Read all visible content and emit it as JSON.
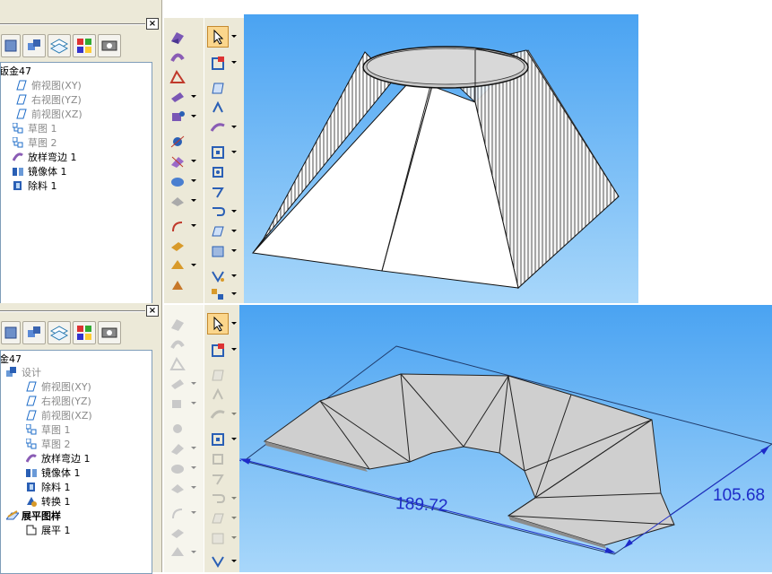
{
  "top_panel": {
    "tree": [
      {
        "label": "钣金47",
        "style": "root"
      },
      {
        "label": "俯视图(XY)",
        "style": "grey"
      },
      {
        "label": "右视图(YZ)",
        "style": "grey"
      },
      {
        "label": "前视图(XZ)",
        "style": "grey"
      },
      {
        "label": "草图 1",
        "style": "grey"
      },
      {
        "label": "草图 2",
        "style": "grey"
      },
      {
        "label": "放样弯边 1",
        "style": "normal"
      },
      {
        "label": "镜像体 1",
        "style": "normal"
      },
      {
        "label": "除料 1",
        "style": "normal"
      }
    ]
  },
  "bottom_panel": {
    "tree": [
      {
        "label": "金47",
        "style": "root"
      },
      {
        "label": "设计",
        "style": "grey"
      },
      {
        "label": "俯视图(XY)",
        "style": "grey"
      },
      {
        "label": "右视图(YZ)",
        "style": "grey"
      },
      {
        "label": "前视图(XZ)",
        "style": "grey"
      },
      {
        "label": "草图 1",
        "style": "grey"
      },
      {
        "label": "草图 2",
        "style": "grey"
      },
      {
        "label": "放样弯边 1",
        "style": "normal"
      },
      {
        "label": "镜像体 1",
        "style": "normal"
      },
      {
        "label": "除料 1",
        "style": "normal"
      },
      {
        "label": "转换 1",
        "style": "normal"
      },
      {
        "label": "展平图样",
        "style": "bold"
      },
      {
        "label": "展平 1",
        "style": "normal"
      }
    ]
  },
  "dimensions": {
    "length": "189.72",
    "width": "105.68"
  },
  "colors": {
    "viewport_top": "#4aa3f2",
    "viewport_bottom": "#a8d7fa",
    "panel_bg": "#ece9d8",
    "dimension": "#1d2bc9"
  },
  "icons": {
    "close": "×"
  }
}
